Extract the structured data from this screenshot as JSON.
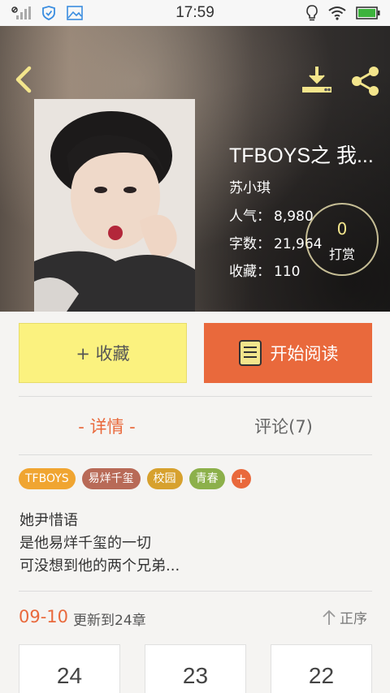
{
  "status_bar": {
    "time": "17:59"
  },
  "hero": {
    "book_title": "TFBOYS之 我...",
    "author": "苏小琪",
    "stats": [
      {
        "label": "人气：",
        "value": "8,980"
      },
      {
        "label": "字数：",
        "value": "21,964"
      },
      {
        "label": "收藏：",
        "value": "110"
      }
    ],
    "tip": {
      "count": "0",
      "label": "打赏"
    }
  },
  "actions": {
    "collect_label": "+ 收藏",
    "read_label": "开始阅读"
  },
  "tabs": {
    "details": "- 详情 -",
    "comments": "评论(7)"
  },
  "tags": [
    {
      "label": "TFBOYS",
      "color": "#f0a531"
    },
    {
      "label": "易烊千玺",
      "color": "#b86a57"
    },
    {
      "label": "校园",
      "color": "#d7a12e"
    },
    {
      "label": "青春",
      "color": "#8cb04a"
    }
  ],
  "tag_add": "+",
  "description": {
    "line1": "她尹惜语",
    "line2": "是他易烊千玺的一切",
    "line3": "可没想到他的两个兄弟..."
  },
  "update": {
    "date": "09-10",
    "text": "更新到24章",
    "sort_label": "正序"
  },
  "chapters": [
    "24",
    "23",
    "22"
  ],
  "colors": {
    "accent": "#e9693c",
    "yellow": "#fbf27f",
    "icon_yellow": "#f3e58c"
  }
}
